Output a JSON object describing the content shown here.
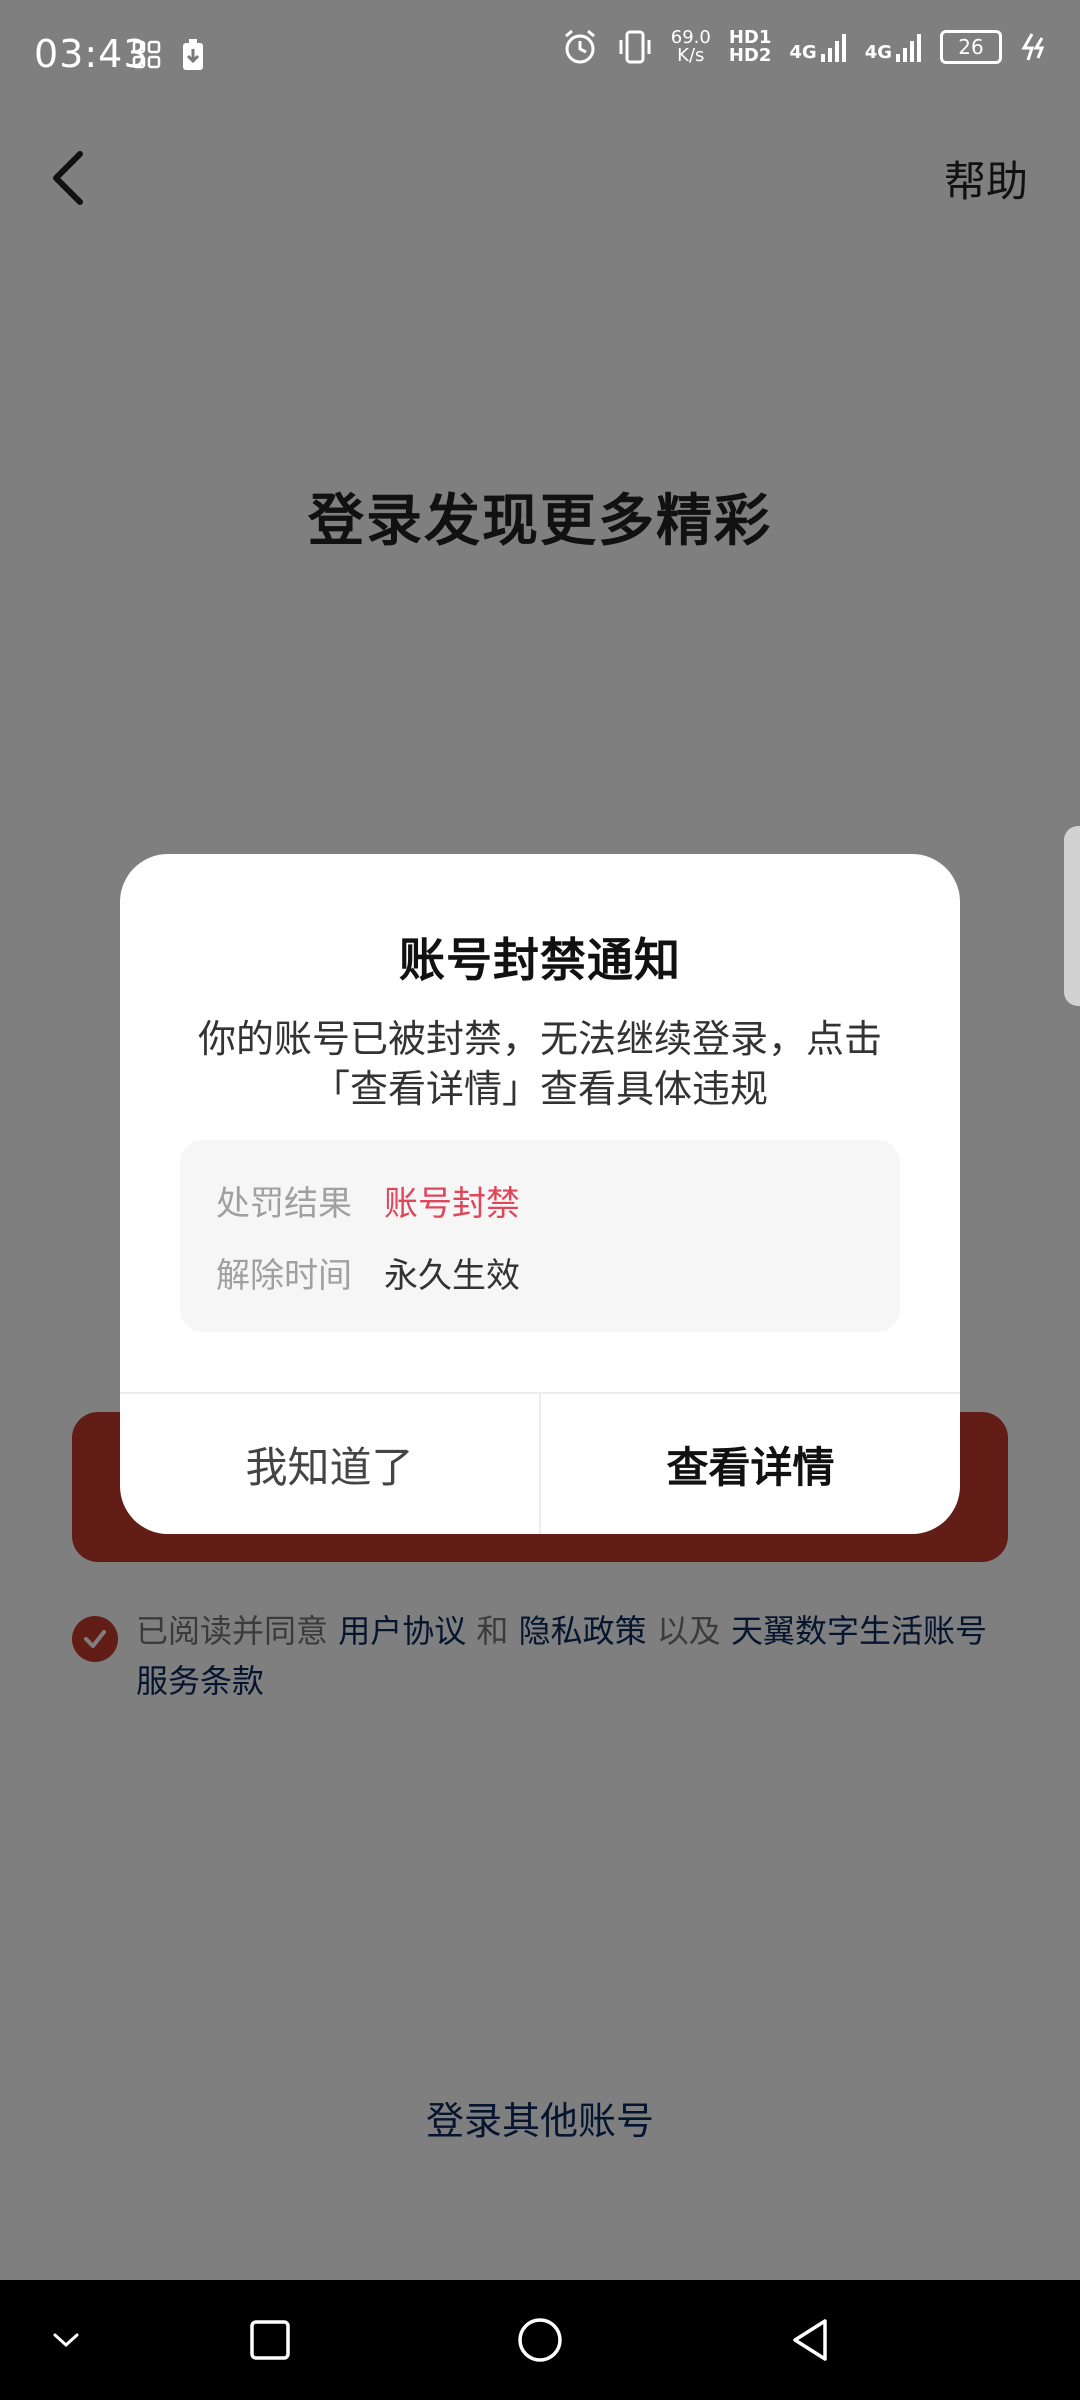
{
  "status_bar": {
    "time": "03:43",
    "net_speed_value": "69.0",
    "net_speed_unit": "K/s",
    "hd1": "HD1",
    "hd2": "HD2",
    "sim1": "4G",
    "sim2": "4G",
    "battery": "26"
  },
  "header": {
    "help_label": "帮助"
  },
  "page": {
    "title": "登录发现更多精彩",
    "other_account_label": "登录其他账号"
  },
  "agreement": {
    "prefix": "已阅读并同意 ",
    "link1": "用户协议",
    "and": " 和 ",
    "link2": "隐私政策",
    "and2": " 以及 ",
    "link3": "天翼数字生活账号服务条款"
  },
  "dialog": {
    "title": "账号封禁通知",
    "message": "你的账号已被封禁，无法继续登录，点击「查看详情」查看具体违规",
    "rows": [
      {
        "label": "处罚结果",
        "value": "账号封禁"
      },
      {
        "label": "解除时间",
        "value": "永久生效"
      }
    ],
    "ok_label": "我知道了",
    "detail_label": "查看详情"
  },
  "colors": {
    "accent_red": "#c53b2c",
    "link_blue": "#0a2b5e",
    "penalty_red": "#e0465a"
  },
  "icons": {
    "back": "chevron-left-icon",
    "check": "check-icon",
    "nav_down": "chevron-down-icon",
    "nav_recent": "square-icon",
    "nav_home": "circle-icon",
    "nav_back": "triangle-back-icon"
  }
}
